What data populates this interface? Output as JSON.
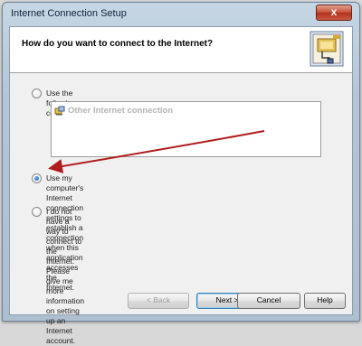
{
  "window": {
    "title": "Internet Connection Setup",
    "close_label": "x"
  },
  "header": {
    "title": "How do you want to connect to the Internet?"
  },
  "options": [
    {
      "label": "Use the following connection:",
      "checked": false
    },
    {
      "label_line1": "Use my computer's Internet connection settings to establish a connection when this",
      "label_line2": "application accesses the Internet.",
      "checked": true
    },
    {
      "label_line1": "I do not have a way to connect to the Internet. Please give me more information on setting",
      "label_line2": "up an Internet account.",
      "checked": false
    }
  ],
  "connection_list": {
    "items": [
      {
        "label": "Other Internet connection",
        "enabled": false
      }
    ]
  },
  "buttons": {
    "back": "< Back",
    "next": "Next >",
    "cancel": "Cancel",
    "help": "Help"
  },
  "colors": {
    "annotation_arrow": "#b01c1c",
    "accent": "#3c7fb1"
  }
}
